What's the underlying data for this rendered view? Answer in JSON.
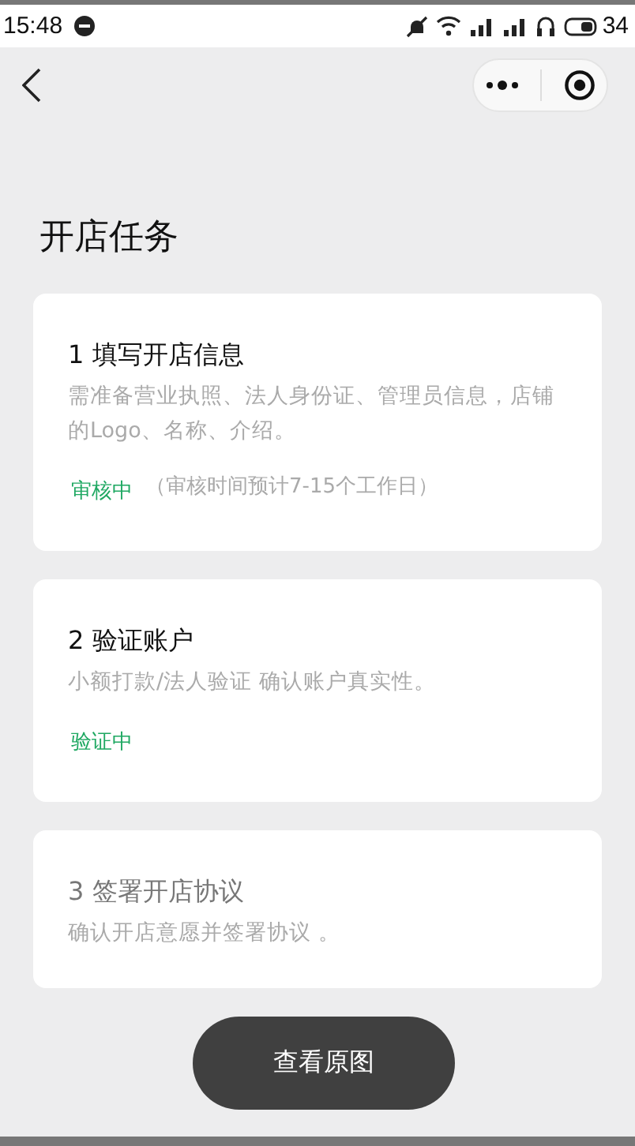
{
  "status_bar": {
    "time": "15:48",
    "battery": "34"
  },
  "page_title": "开店任务",
  "tasks": [
    {
      "title": "1 填写开店信息",
      "description": "需准备营业执照、法人身份证、管理员信息，店铺的Logo、名称、介绍。",
      "status": "审核中",
      "note": "（审核时间预计7-15个工作日）",
      "disabled": false
    },
    {
      "title": "2 验证账户",
      "description": "小额打款/法人验证 确认账户真实性。",
      "status": "验证中",
      "disabled": false
    },
    {
      "title": "3 签署开店协议",
      "description": "确认开店意愿并签署协议 。",
      "disabled": true
    }
  ],
  "floating_button": "查看原图"
}
